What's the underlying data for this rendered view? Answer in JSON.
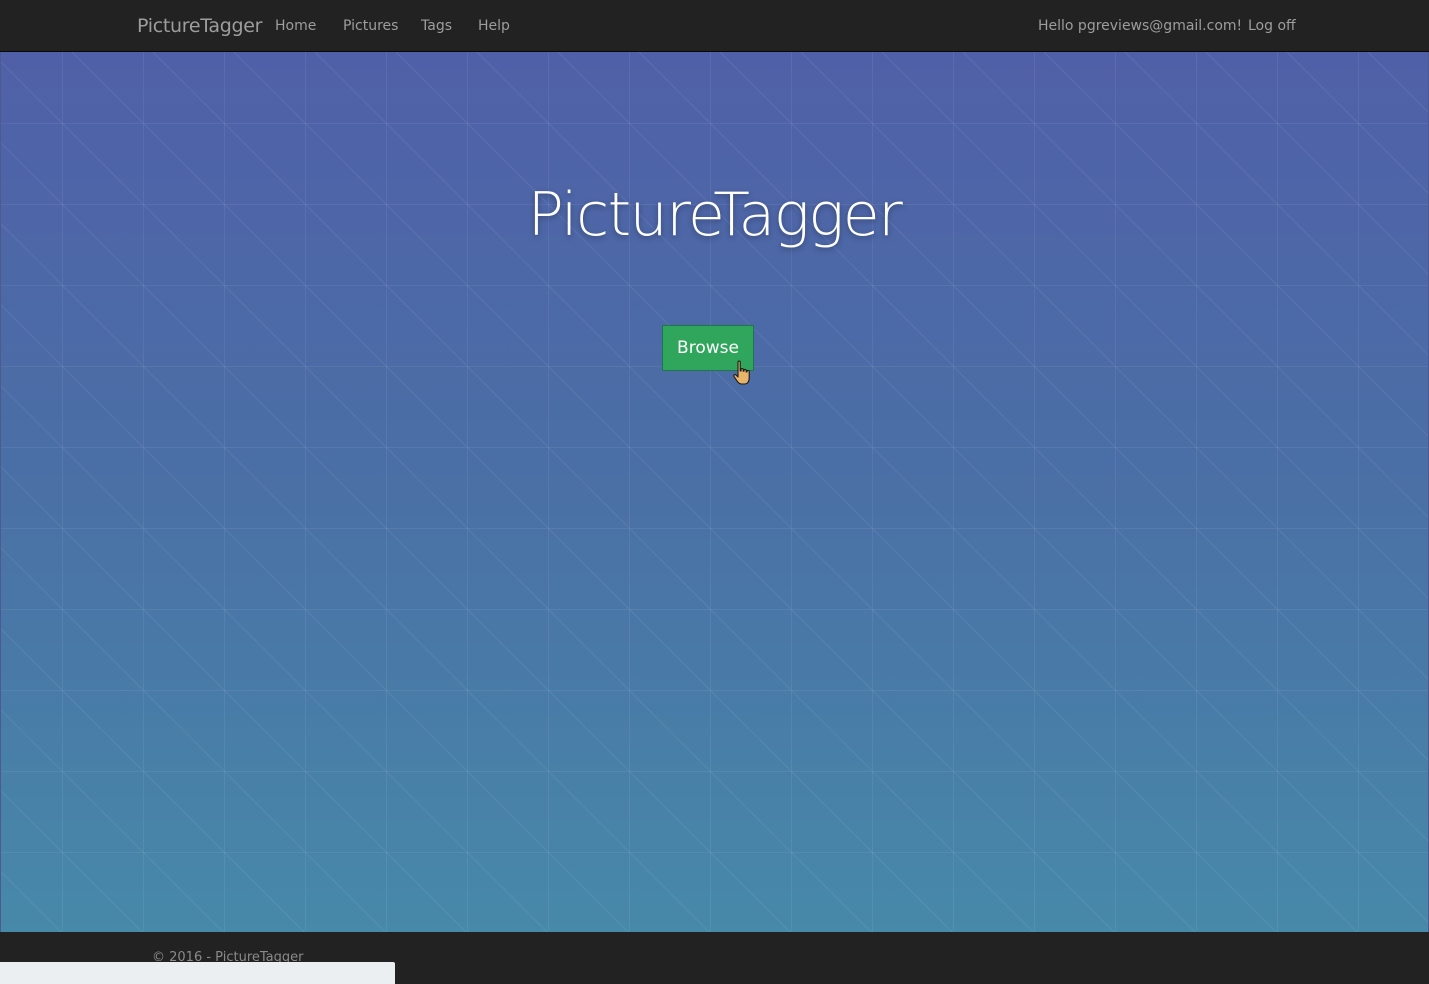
{
  "nav": {
    "brand": "PictureTagger",
    "links": [
      "Home",
      "Pictures",
      "Tags",
      "Help"
    ],
    "greeting": "Hello pgreviews@gmail.com!",
    "logoff": "Log off"
  },
  "hero": {
    "title": "PictureTagger",
    "browse_label": "Browse"
  },
  "footer": {
    "copyright": "© 2016 - PictureTagger"
  },
  "colors": {
    "navbar": "#222222",
    "nav_text": "#9d9d9d",
    "hero_top": "#5060a8",
    "hero_bottom": "#4789a9",
    "browse_button": "#2fa65c"
  },
  "icons": [
    "hand-pointer-cursor-icon"
  ]
}
